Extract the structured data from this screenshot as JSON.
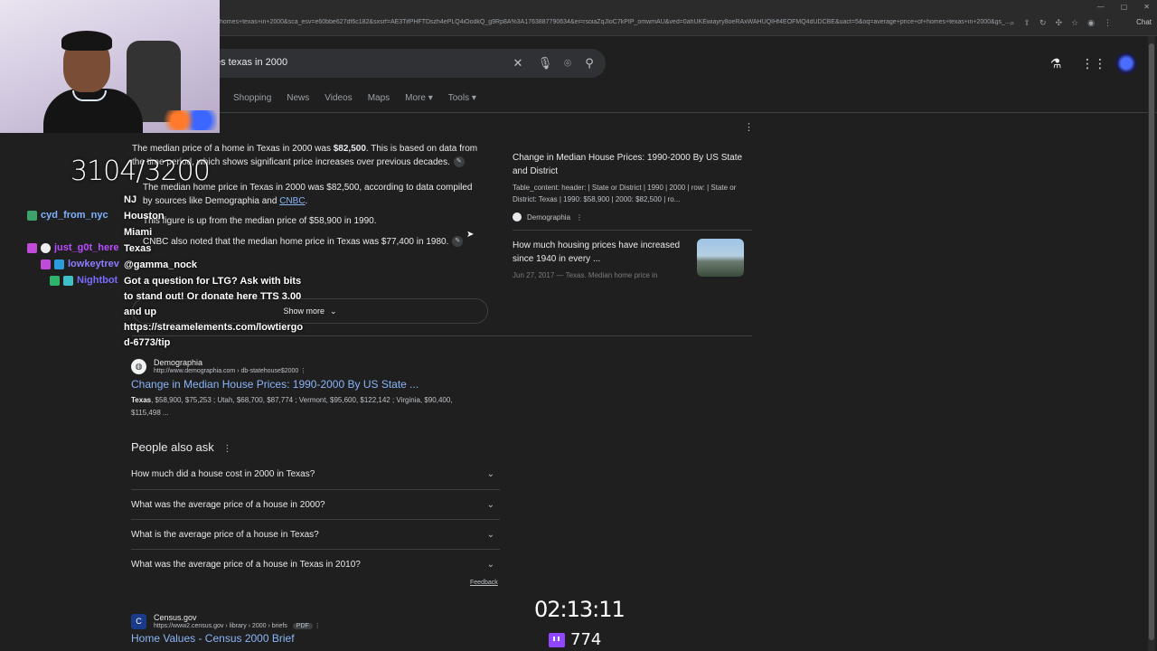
{
  "browser": {
    "url": "homes+texas+in+2000&sca_esv=e60bbe627df6c182&sxsrf=AE3TifPHFTDszh4ePLQ4iOodkQ_g9Rp8A%3A1763887790634&ei=rsoiaZqJIoC7kPIP_omwmAU&ved=0ahUKEwiayry8oeRAxWAHUQIHf4EOFMQ4dUDCBE&uact=5&oq=average+price+of+homes+texas+in+2000&gs_...",
    "chat_label": "Chat"
  },
  "search": {
    "query": "es texas in 2000"
  },
  "tabs": [
    "s",
    "Shopping",
    "News",
    "Videos",
    "Maps",
    "More",
    "Tools"
  ],
  "overview": {
    "intro_a": "The median price of a home in Texas in 2000 was ",
    "intro_bold": "$82,500",
    "intro_b": ". This is based on data from",
    "intro_line2": "the time period, which shows significant price increases over previous decades.",
    "bullet1_line1": "The median home price in Texas in 2000 was $82,500, according to data compiled",
    "bullet1_line2a": "by sources like Demographia and ",
    "bullet1_link": "CNBC",
    "bullet1_line2b": ".",
    "bullet2": "This figure is up from the median price of $58,900 in 1990.",
    "bullet3": "CNBC also noted that the median home price in Texas was $77,400 in 1980.",
    "show_more": "Show more"
  },
  "side_cards": [
    {
      "title": "Change in Median House Prices: 1990-2000 By US State and District",
      "snippet": "Table_content: header: | State or District | 1990 | 2000 | row: | State or District: Texas | 1990: $58,900 | 2000: $82,500 | ro...",
      "source": "Demographia"
    },
    {
      "title": "How much housing prices have increased since 1940 in every ...",
      "snippet": "Jun 27, 2017 — Texas. Median home price in"
    }
  ],
  "result1": {
    "site": "Demographia",
    "url": "http://www.demographia.com › db-statehouse$2000",
    "title": "Change in Median House Prices: 1990-2000 By US State ...",
    "snippet_bold": "Texas",
    "snippet": ", $58,900, $75,253 ; Utah, $68,700, $87,774 ; Vermont, $95,600, $122,142 ; Virginia, $90,400, $115,498 ..."
  },
  "paa": {
    "title": "People also ask",
    "questions": [
      "How much did a house cost in 2000 in Texas?",
      "What was the average price of a house in 2000?",
      "What is the average price of a house in Texas?",
      "What was the average price of a house in Texas in 2010?"
    ],
    "feedback": "Feedback"
  },
  "result2": {
    "site": "Census.gov",
    "url": "https://www2.census.gov › library › 2000 › briefs",
    "badge": "PDF",
    "title": "Home Values - Census 2000 Brief"
  },
  "overlay": {
    "counter": "3104/3200",
    "timer": "02:13:11",
    "viewers": "774",
    "chat": [
      {
        "user": "cyd_from_nyc",
        "color": "#7fb2ff",
        "msg": "Houston"
      },
      {
        "user": "just_g0t_here",
        "color": "#b84dff",
        "msg": "Texas"
      },
      {
        "user": "lowkeytrev",
        "color": "#8a7cff",
        "msg": "@gamma_nock"
      },
      {
        "user": "Nightbot",
        "color": "#7a6cff",
        "msg": "Got a question for LTG? Ask with bits"
      }
    ],
    "msg_nj": "NJ",
    "msg_miami": "Miami",
    "nightbot_lines": [
      "to stand out! Or donate here TTS 3.00",
      "and up",
      "https://streamelements.com/lowtiergo",
      "d-6773/tip"
    ]
  }
}
